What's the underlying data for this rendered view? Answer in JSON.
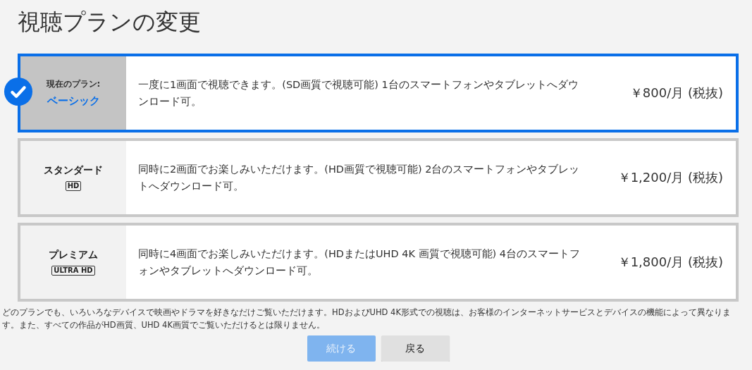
{
  "title": "視聴プランの変更",
  "plans": [
    {
      "current_label": "現在のプラン:",
      "name": "ベーシック",
      "description": "一度に1画面で視聴できます。(SD画質で視聴可能) 1台のスマートフォンやタブレットへダウンロード可。",
      "price": "￥800/月 (税抜)",
      "selected": true
    },
    {
      "name": "スタンダード",
      "badge": "HD",
      "description": "同時に2画面でお楽しみいただけます。(HD画質で視聴可能) 2台のスマートフォンやタブレットへダウンロード可。",
      "price": "￥1,200/月 (税抜)",
      "selected": false
    },
    {
      "name": "プレミアム",
      "badge": "ULTRA **HD**",
      "description": "同時に4画面でお楽しみいただけます。(HDまたはUHD 4K 画質で視聴可能) 4台のスマートフォンやタブレットへダウンロード可。",
      "price": "￥1,800/月 (税抜)",
      "selected": false
    }
  ],
  "footnote": "どのプランでも、いろいろなデバイスで映画やドラマを好きなだけご覧いただけます。HDおよびUHD 4K形式での視聴は、お客様のインターネットサービスとデバイスの機能によって異なります。また、すべての作品がHD画質、UHD 4K画質でご覧いただけるとは限りません。",
  "buttons": [
    {
      "label": "続ける",
      "kind": "primary",
      "disabled": true
    },
    {
      "label": "戻る",
      "kind": "secondary",
      "disabled": false
    }
  ]
}
